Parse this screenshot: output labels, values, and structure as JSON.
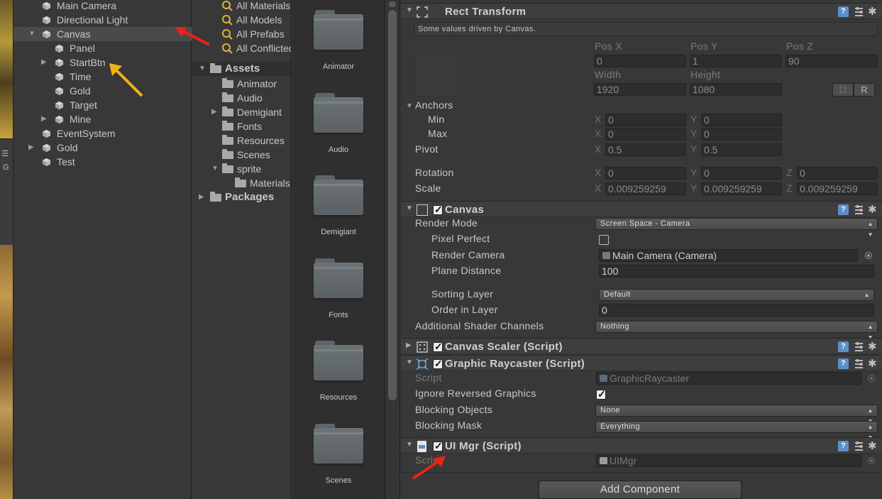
{
  "scene_strip": {
    "letter": "G"
  },
  "hierarchy": {
    "items": [
      {
        "label": "Main Camera",
        "depth": 0,
        "expander": ""
      },
      {
        "label": "Directional Light",
        "depth": 0,
        "expander": ""
      },
      {
        "label": "Canvas",
        "depth": 0,
        "expander": "▼",
        "selected": true
      },
      {
        "label": "Panel",
        "depth": 1,
        "expander": ""
      },
      {
        "label": "StartBtn",
        "depth": 1,
        "expander": "▶"
      },
      {
        "label": "Time",
        "depth": 1,
        "expander": ""
      },
      {
        "label": "Gold",
        "depth": 1,
        "expander": ""
      },
      {
        "label": "Target",
        "depth": 1,
        "expander": ""
      },
      {
        "label": "Mine",
        "depth": 1,
        "expander": "▶"
      },
      {
        "label": "EventSystem",
        "depth": 0,
        "expander": ""
      },
      {
        "label": "Gold",
        "depth": 0,
        "expander": "▶"
      },
      {
        "label": "Test",
        "depth": 0,
        "expander": ""
      }
    ]
  },
  "project_tree": {
    "favorites": [
      "All Materials",
      "All Models",
      "All Prefabs",
      "All Conflicted"
    ],
    "assets_label": "Assets",
    "assets_children": [
      {
        "label": "Animator",
        "expander": ""
      },
      {
        "label": "Audio",
        "expander": ""
      },
      {
        "label": "Demigiant",
        "expander": "▶"
      },
      {
        "label": "Fonts",
        "expander": ""
      },
      {
        "label": "Resources",
        "expander": ""
      },
      {
        "label": "Scenes",
        "expander": ""
      },
      {
        "label": "sprite",
        "expander": "▼"
      }
    ],
    "sprite_children": [
      "Materials"
    ],
    "packages_label": "Packages"
  },
  "project_grid": {
    "folders": [
      "Animator",
      "Audio",
      "Demigiant",
      "Fonts",
      "Resources",
      "Scenes"
    ]
  },
  "inspector": {
    "rect_transform": {
      "title": "Rect Transform",
      "driven_note": "Some values driven by Canvas.",
      "pos_x_label": "Pos X",
      "pos_y_label": "Pos Y",
      "pos_z_label": "Pos Z",
      "pos_x": "0",
      "pos_y": "1",
      "pos_z": "90",
      "width_label": "Width",
      "height_label": "Height",
      "width": "1920",
      "height": "1080",
      "r_button": "R",
      "anchors_label": "Anchors",
      "min_label": "Min",
      "max_label": "Max",
      "min_x": "0",
      "min_y": "0",
      "max_x": "0",
      "max_y": "0",
      "pivot_label": "Pivot",
      "pivot_x": "0.5",
      "pivot_y": "0.5",
      "rotation_label": "Rotation",
      "rot_x": "0",
      "rot_y": "0",
      "rot_z": "0",
      "scale_label": "Scale",
      "scale_x": "0.009259259",
      "scale_y": "0.009259259",
      "scale_z": "0.009259259",
      "axis_x": "X",
      "axis_y": "Y",
      "axis_z": "Z"
    },
    "canvas": {
      "title": "Canvas",
      "render_mode_label": "Render Mode",
      "render_mode": "Screen Space - Camera",
      "pixel_perfect_label": "Pixel Perfect",
      "render_camera_label": "Render Camera",
      "render_camera": "Main Camera (Camera)",
      "plane_distance_label": "Plane Distance",
      "plane_distance": "100",
      "sorting_layer_label": "Sorting Layer",
      "sorting_layer": "Default",
      "order_in_layer_label": "Order in Layer",
      "order_in_layer": "0",
      "shader_channels_label": "Additional Shader Channels",
      "shader_channels": "Nothing"
    },
    "canvas_scaler": {
      "title": "Canvas Scaler (Script)"
    },
    "graphic_raycaster": {
      "title": "Graphic Raycaster (Script)",
      "script_label": "Script",
      "script_value": "GraphicRaycaster",
      "ignore_reversed_label": "Ignore Reversed Graphics",
      "blocking_objects_label": "Blocking Objects",
      "blocking_objects": "None",
      "blocking_mask_label": "Blocking Mask",
      "blocking_mask": "Everything"
    },
    "ui_mgr": {
      "title": "UI Mgr (Script)",
      "script_label": "Script",
      "script_value": "UIMgr"
    },
    "add_component": "Add Component"
  },
  "colors": {
    "annotation_red": "#e8231b",
    "annotation_yellow": "#f2b21a",
    "help_blue": "#5d8fc9"
  }
}
